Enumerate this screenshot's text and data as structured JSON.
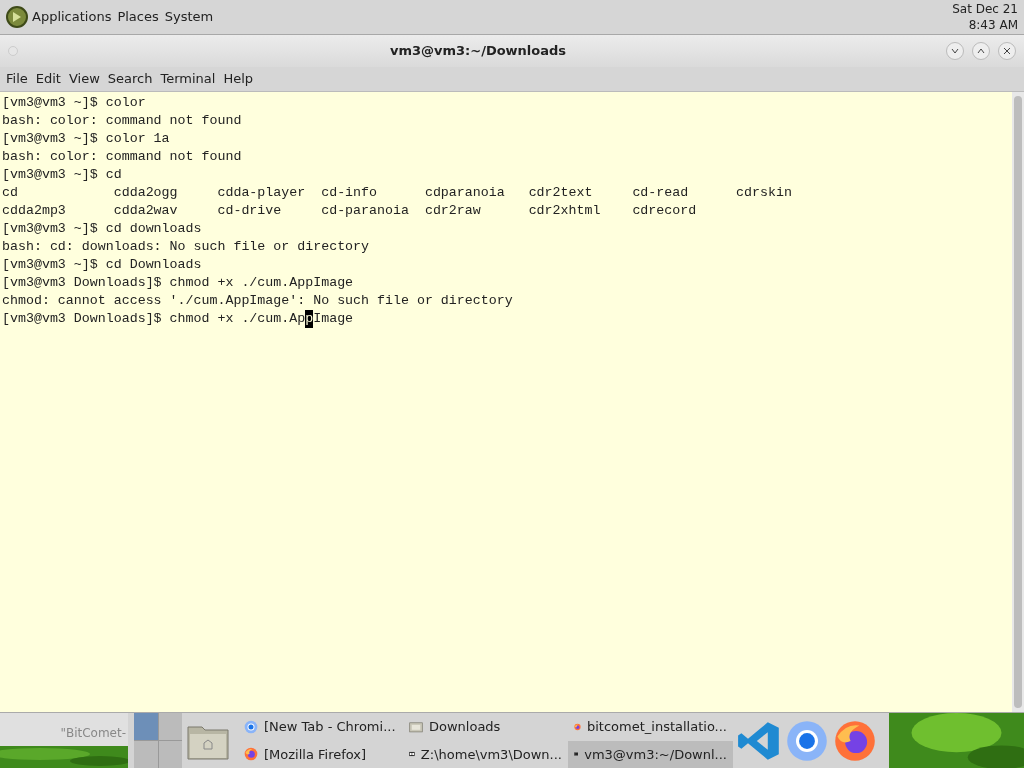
{
  "top_panel": {
    "menus": [
      "Applications",
      "Places",
      "System"
    ],
    "clock": {
      "date": "Sat Dec 21",
      "time": "8:43 AM"
    }
  },
  "window": {
    "title": "vm3@vm3:~/Downloads",
    "menu": [
      "File",
      "Edit",
      "View",
      "Search",
      "Terminal",
      "Help"
    ]
  },
  "terminal": {
    "lines": [
      {
        "kind": "text",
        "text": "[vm3@vm3 ~]$ color"
      },
      {
        "kind": "text",
        "text": "bash: color: command not found"
      },
      {
        "kind": "text",
        "text": "[vm3@vm3 ~]$ color 1a"
      },
      {
        "kind": "text",
        "text": "bash: color: command not found"
      },
      {
        "kind": "text",
        "text": "[vm3@vm3 ~]$ cd"
      },
      {
        "kind": "text",
        "text": "cd            cdda2ogg     cdda-player  cd-info      cdparanoia   cdr2text     cd-read      cdrskin"
      },
      {
        "kind": "text",
        "text": "cdda2mp3      cdda2wav     cd-drive     cd-paranoia  cdr2raw      cdr2xhtml    cdrecord"
      },
      {
        "kind": "text",
        "text": "[vm3@vm3 ~]$ cd downloads"
      },
      {
        "kind": "text",
        "text": "bash: cd: downloads: No such file or directory"
      },
      {
        "kind": "text",
        "text": "[vm3@vm3 ~]$ cd Downloads"
      },
      {
        "kind": "text",
        "text": "[vm3@vm3 Downloads]$ chmod +x ./cum.AppImage"
      },
      {
        "kind": "text",
        "text": "chmod: cannot access './cum.AppImage': No such file or directory"
      },
      {
        "kind": "cursor",
        "before": "[vm3@vm3 Downloads]$ chmod +x ./cum.Ap",
        "cursor": "p",
        "after": "Image"
      }
    ]
  },
  "taskbar": {
    "desktop_label": "\"BitComet-",
    "tasks": [
      {
        "label": "[New Tab - Chromi...",
        "kind": "chromium",
        "selected": false
      },
      {
        "label": "Downloads",
        "kind": "folder",
        "selected": false
      },
      {
        "label": "bitcomet_installatio...",
        "kind": "firefox",
        "selected": false
      },
      {
        "label": "[Mozilla Firefox]",
        "kind": "firefox",
        "selected": false
      },
      {
        "label": "Z:\\home\\vm3\\Down...",
        "kind": "sevenzip",
        "selected": false
      },
      {
        "label": "vm3@vm3:~/Downl...",
        "kind": "terminal",
        "selected": true
      }
    ],
    "launchers": [
      {
        "kind": "vscode"
      },
      {
        "kind": "chromium"
      },
      {
        "kind": "firefox"
      }
    ]
  }
}
